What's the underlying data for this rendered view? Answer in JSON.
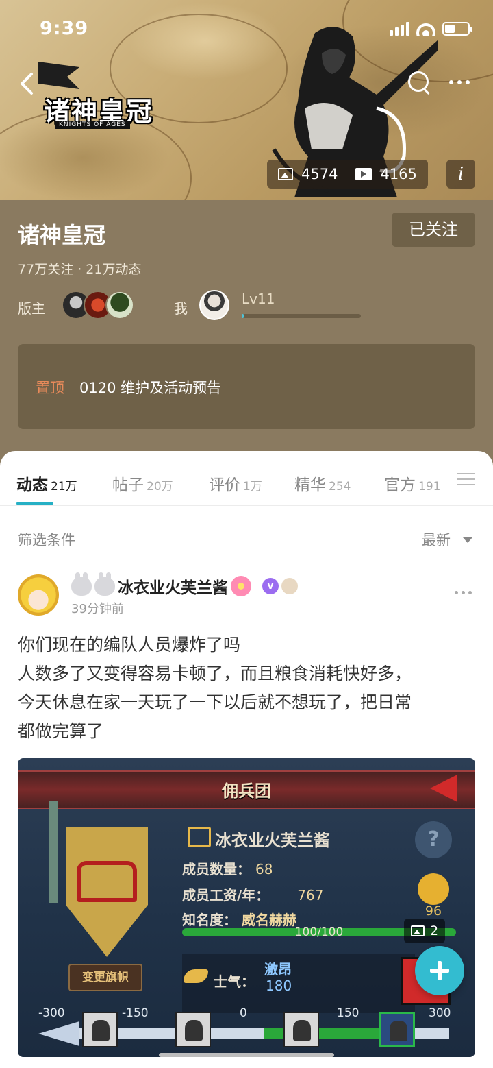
{
  "status_bar": {
    "time": "9:39"
  },
  "header": {
    "logo_title": "诸神皇冠",
    "logo_subtitle": "KNIGHTS OF AGES",
    "media": {
      "image_count": "4574",
      "video_count": "4165"
    },
    "info_label": "i"
  },
  "game": {
    "title": "诸神皇冠",
    "follow_label": "已关注",
    "stats": "77万关注 · 21万动态",
    "moderators_label": "版主",
    "me_label": "我",
    "level": "Lv11",
    "level_progress": 0.02,
    "pinned": {
      "tag": "置顶",
      "text": "0120 维护及活动预告"
    }
  },
  "tabs": [
    {
      "label": "动态",
      "count": "21万",
      "active": true
    },
    {
      "label": "帖子",
      "count": "20万"
    },
    {
      "label": "评价",
      "count": "1万"
    },
    {
      "label": "精华",
      "count": "254"
    },
    {
      "label": "官方",
      "count": "191"
    }
  ],
  "filter": {
    "label": "筛选条件",
    "sort": "最新"
  },
  "post": {
    "username": "冰衣业火芙兰酱",
    "time": "39分钟前",
    "body": [
      "你们现在的编队人员爆炸了吗",
      "人数多了又变得容易卡顿了，而且粮食消耗快好多，",
      "今天休息在家一天玩了一下以后就不想玩了，把日常",
      "都做完算了"
    ],
    "image_count": "2",
    "image": {
      "title": "佣兵团",
      "guild_name": "冰衣业火芙兰酱",
      "members_label": "成员数量：",
      "members_value": "68",
      "salary_label": "成员工资/年：",
      "salary_value": "767",
      "fame_label": "知名度：",
      "fame_value": "威名赫赫",
      "fame_progress": "100/100",
      "morale_label": "士气：",
      "morale_state": "激昂",
      "morale_value": "180",
      "score": "96",
      "change_flag": "变更旗帜",
      "scale_ticks": [
        "-300",
        "-150",
        "0",
        "150",
        "300"
      ]
    }
  },
  "colors": {
    "accent": "#26b0c5",
    "pin_tag": "#e88a5a",
    "info_bg": "#8a7a60"
  }
}
